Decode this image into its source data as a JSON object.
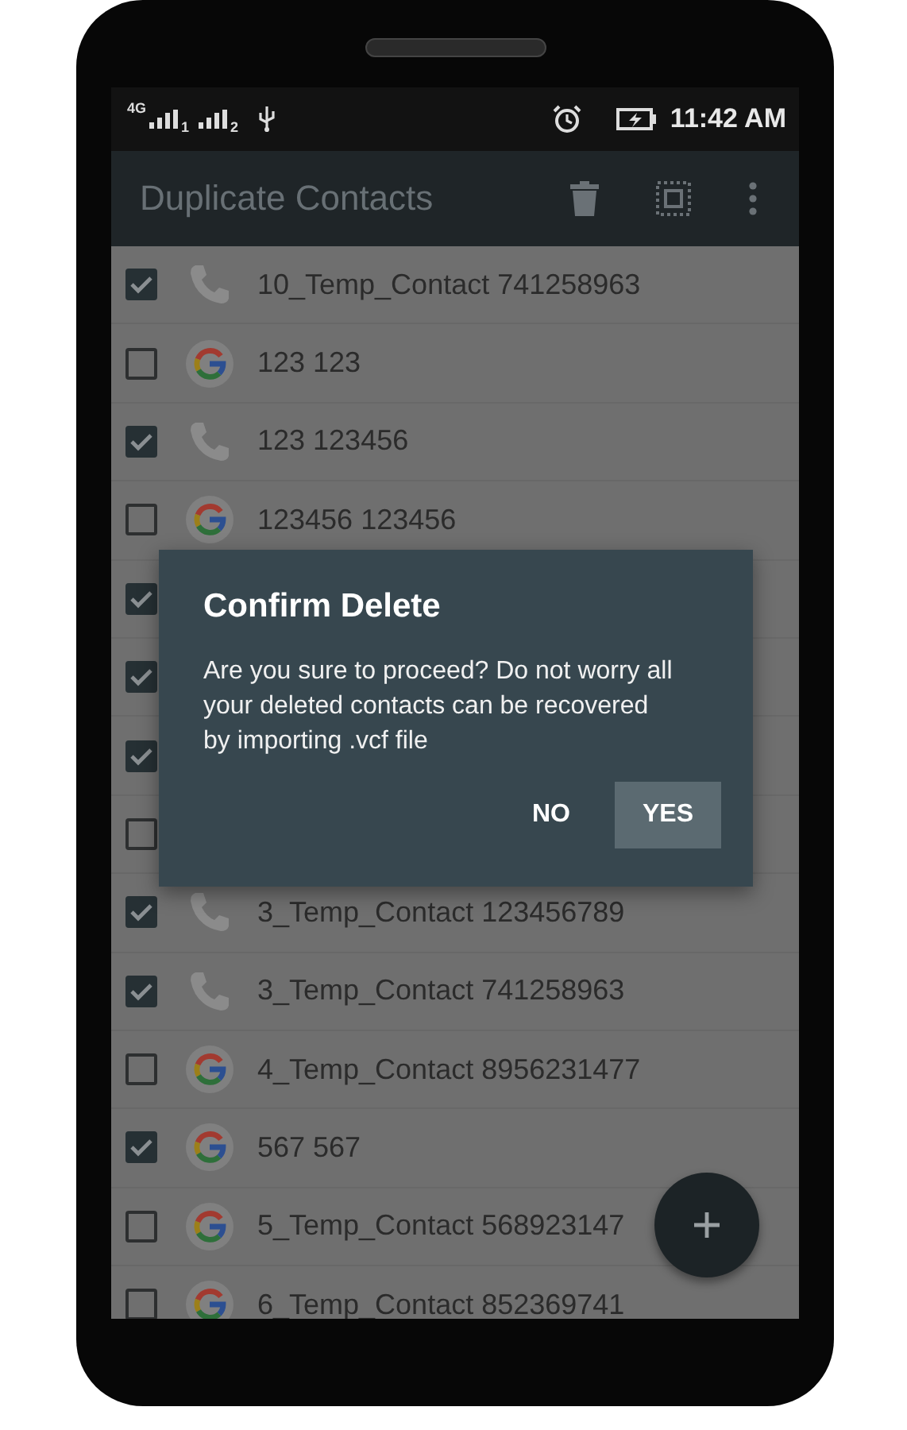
{
  "status_bar": {
    "network": "4G",
    "sim_1": "1",
    "sim_2": "2",
    "time": "11:42 AM"
  },
  "app_bar": {
    "title": "Duplicate Contacts"
  },
  "rows": [
    {
      "kind": "phone",
      "checked": true,
      "name": "10_Temp_Contact 741258963"
    },
    {
      "kind": "google",
      "checked": false,
      "name": "123 123"
    },
    {
      "kind": "phone",
      "checked": true,
      "name": "123 123456"
    },
    {
      "kind": "google",
      "checked": false,
      "name": "123456 123456"
    },
    {
      "checked": true
    },
    {
      "checked": true
    },
    {
      "checked": true
    },
    {
      "checked": false
    },
    {
      "kind": "phone",
      "checked": true,
      "name": "3_Temp_Contact 123456789"
    },
    {
      "kind": "phone",
      "checked": true,
      "name": "3_Temp_Contact 741258963"
    },
    {
      "kind": "google",
      "checked": false,
      "name": "4_Temp_Contact 8956231477"
    },
    {
      "kind": "google",
      "checked": true,
      "name": "567 567"
    },
    {
      "kind": "google",
      "checked": false,
      "name": "5_Temp_Contact 568923147"
    },
    {
      "kind": "google",
      "checked": false,
      "name": "6_Temp_Contact 852369741"
    }
  ],
  "dialog": {
    "title": "Confirm Delete",
    "message": "Are you sure to proceed? Do not worry all your deleted contacts can be recovered by importing .vcf file",
    "buttons": [
      {
        "label": "NO",
        "kind": "text"
      },
      {
        "label": "YES",
        "kind": "filled"
      }
    ]
  }
}
